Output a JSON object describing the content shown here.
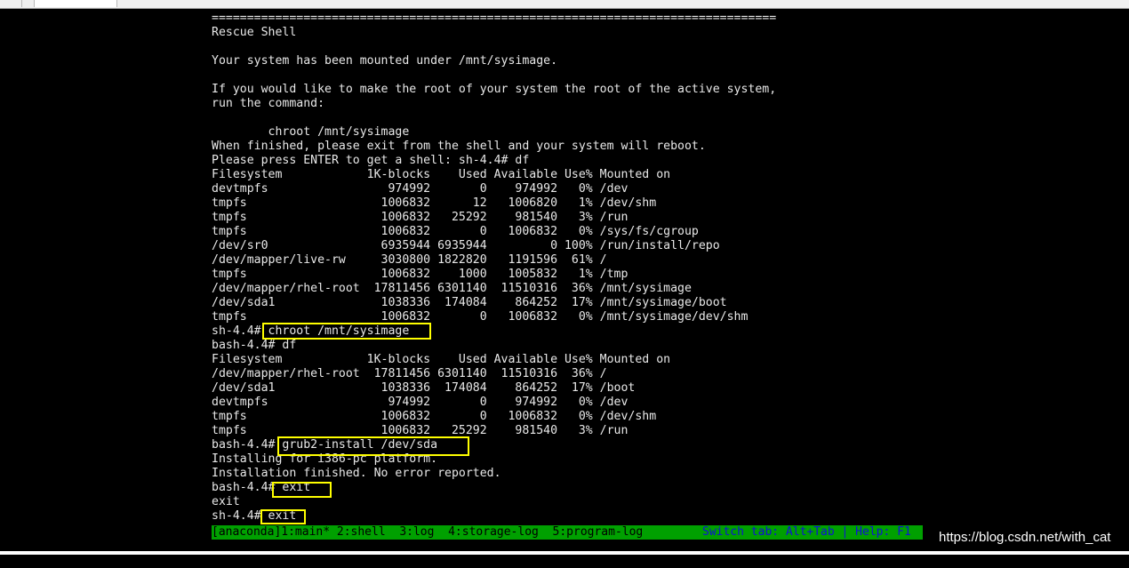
{
  "terminal": {
    "lines": [
      "================================================================================",
      "Rescue Shell",
      "",
      "Your system has been mounted under /mnt/sysimage.",
      "",
      "If you would like to make the root of your system the root of the active system,",
      "run the command:",
      "",
      "        chroot /mnt/sysimage",
      "When finished, please exit from the shell and your system will reboot.",
      "Please press ENTER to get a shell: sh-4.4# df",
      "Filesystem            1K-blocks    Used Available Use% Mounted on",
      "devtmpfs                 974992       0    974992   0% /dev",
      "tmpfs                   1006832      12   1006820   1% /dev/shm",
      "tmpfs                   1006832   25292    981540   3% /run",
      "tmpfs                   1006832       0   1006832   0% /sys/fs/cgroup",
      "/dev/sr0                6935944 6935944         0 100% /run/install/repo",
      "/dev/mapper/live-rw     3030800 1822820   1191596  61% /",
      "tmpfs                   1006832    1000   1005832   1% /tmp",
      "/dev/mapper/rhel-root  17811456 6301140  11510316  36% /mnt/sysimage",
      "/dev/sda1               1038336  174084    864252  17% /mnt/sysimage/boot",
      "tmpfs                   1006832       0   1006832   0% /mnt/sysimage/dev/shm",
      "sh-4.4# chroot /mnt/sysimage",
      "bash-4.4# df",
      "Filesystem            1K-blocks    Used Available Use% Mounted on",
      "/dev/mapper/rhel-root  17811456 6301140  11510316  36% /",
      "/dev/sda1               1038336  174084    864252  17% /boot",
      "devtmpfs                 974992       0    974992   0% /dev",
      "tmpfs                   1006832       0   1006832   0% /dev/shm",
      "tmpfs                   1006832   25292    981540   3% /run",
      "bash-4.4# grub2-install /dev/sda",
      "Installing for i386-pc platform.",
      "Installation finished. No error reported.",
      "bash-4.4# exit",
      "exit",
      "sh-4.4# exit"
    ]
  },
  "statusbar": {
    "tabs": "[anaconda]1:main* 2:shell  3:log  4:storage-log  5:program-log",
    "help": "Switch tab: Alt+Tab | Help: F1"
  },
  "watermark": "https://blog.csdn.net/with_cat",
  "colors": {
    "background": "#000000",
    "text": "#e8e8e8",
    "highlight": "#ffff00",
    "statusbar": "#00a000",
    "help_text": "#1010d8"
  }
}
